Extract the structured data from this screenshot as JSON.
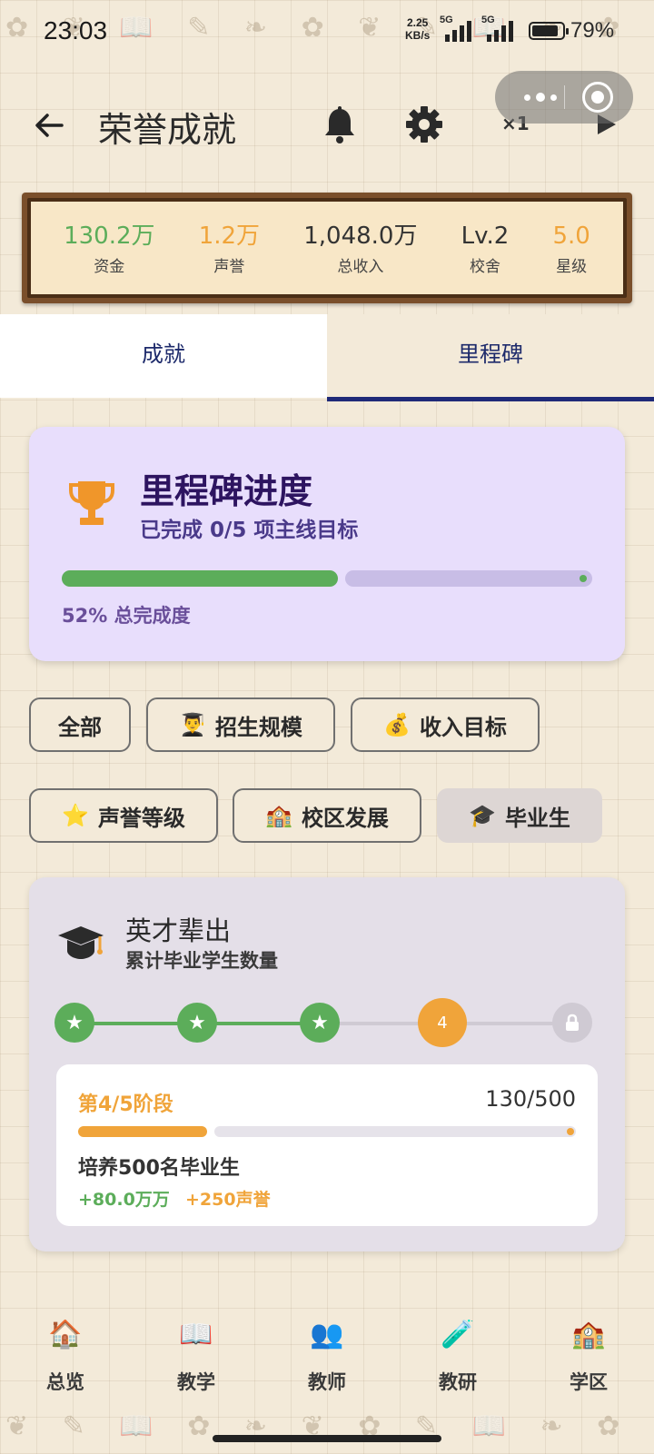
{
  "status_bar": {
    "time": "23:03",
    "net_speed": "2.25",
    "net_unit": "KB/s",
    "signal_1": "5G",
    "signal_2": "5G",
    "battery": "79%"
  },
  "header": {
    "title": "荣誉成就",
    "speed": "×1"
  },
  "stats": [
    {
      "value": "130.2万",
      "label": "资金",
      "color": "#5cad5a"
    },
    {
      "value": "1.2万",
      "label": "声誉",
      "color": "#f0a43a"
    },
    {
      "value": "1,048.0万",
      "label": "总收入",
      "color": "#333333"
    },
    {
      "value": "Lv.2",
      "label": "校舍",
      "color": "#333333"
    },
    {
      "value": "5.0",
      "label": "星级",
      "color": "#f0a43a"
    }
  ],
  "tabs": [
    {
      "label": "成就",
      "active": false
    },
    {
      "label": "里程碑",
      "active": true
    }
  ],
  "progress": {
    "title": "里程碑进度",
    "subtitle": "已完成 0/5 项主线目标",
    "percent_text": "52% 总完成度",
    "fraction": 0.52
  },
  "filters": [
    {
      "icon": "",
      "label": "全部"
    },
    {
      "icon": "👨‍🎓",
      "label": "招生规模"
    },
    {
      "icon": "💰",
      "label": "收入目标"
    },
    {
      "icon": "⭐",
      "label": "声誉等级"
    },
    {
      "icon": "🏫",
      "label": "校区发展"
    },
    {
      "icon": "🎓",
      "label": "毕业生",
      "selected": true
    }
  ],
  "milestone": {
    "title": "英才辈出",
    "subtitle": "累计毕业学生数量",
    "steps": [
      {
        "state": "done",
        "text": "★"
      },
      {
        "state": "done",
        "text": "★"
      },
      {
        "state": "done",
        "text": "★"
      },
      {
        "state": "current",
        "text": "4"
      },
      {
        "state": "locked",
        "text": ""
      }
    ],
    "stage": "第4/5阶段",
    "count": "130/500",
    "fraction": 0.26,
    "goal": "培养500名毕业生",
    "reward_money": "+80.0万万",
    "reward_rep": "+250声誉"
  },
  "bottom_nav": [
    {
      "icon": "🏠",
      "label": "总览"
    },
    {
      "icon": "📖",
      "label": "教学"
    },
    {
      "icon": "👥",
      "label": "教师"
    },
    {
      "icon": "🧪",
      "label": "教研"
    },
    {
      "icon": "🏫",
      "label": "学区"
    }
  ],
  "colors": {
    "green": "#5cad5a",
    "orange": "#f0a43a",
    "navy": "#1f2a78",
    "purple_card": "#e8defc"
  }
}
